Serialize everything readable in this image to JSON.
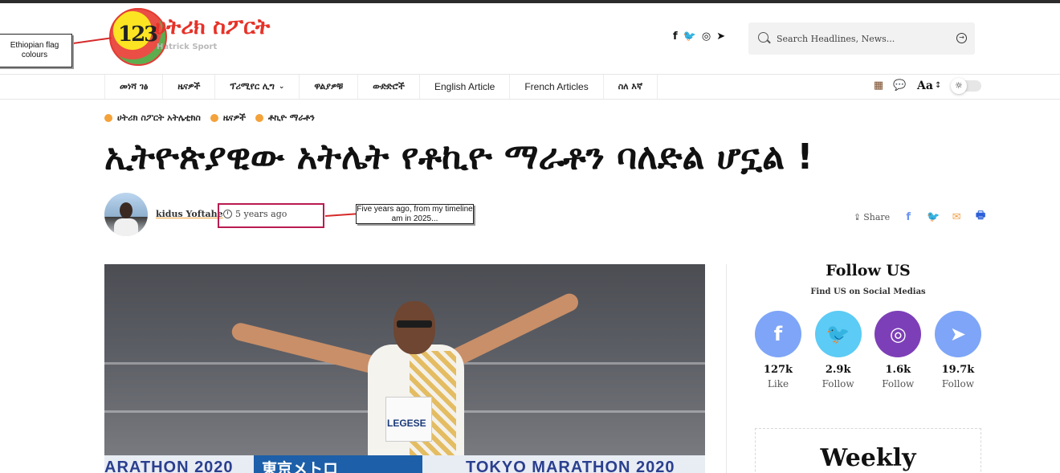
{
  "header": {
    "logo_text": "ሀትሪክ ስፖርት",
    "logo_sub": "Hatrick Sport",
    "logo_numbers": "123",
    "social_icons": [
      "facebook-icon",
      "twitter-icon",
      "instagram-icon",
      "telegram-icon"
    ],
    "search_placeholder": "Search Headlines, News..."
  },
  "annotations": {
    "flag_note": "Ethiopian flag colours",
    "time_note": "Five years ago, from my timeline am  in  2025..."
  },
  "nav": {
    "items": [
      {
        "label": "መነሻ ገፅ"
      },
      {
        "label": "ዜናዎች"
      },
      {
        "label": "ፕሪሚየር ሊግ"
      },
      {
        "label": "ዋልያዎቹ"
      },
      {
        "label": "ውድድሮች"
      },
      {
        "label": "English Article"
      },
      {
        "label": "French Articles"
      },
      {
        "label": "ስለ እኛ"
      }
    ],
    "font_size_label": "Aa"
  },
  "article": {
    "categories": [
      "ሀትሪክ ስፖርት አትሌቲክስ",
      "ዜናዎች",
      "ቶኪዮ ማራቶን"
    ],
    "title": "ኢትዮጵያዊው አትሌት የቶኪዮ ማራቶን ባለድል ሆኗል !",
    "author": "kidus Yoftahe",
    "time": "5 years ago",
    "share_label": "Share",
    "image": {
      "bib_name": "LEGESE",
      "banner_left": "ARATHON 2020",
      "banner_logo": "東京メトロ",
      "banner_right": "TOKYO MARATHON 2020"
    }
  },
  "sidebar": {
    "follow_title": "Follow US",
    "follow_sub": "Find US on Social Medias",
    "networks": [
      {
        "icon": "facebook-icon",
        "glyph": "f",
        "count": "127k",
        "label": "Like",
        "color": "#7ea5f7"
      },
      {
        "icon": "twitter-icon",
        "glyph": "🐦",
        "count": "2.9k",
        "label": "Follow",
        "color": "#5ccbf5"
      },
      {
        "icon": "instagram-icon",
        "glyph": "◎",
        "count": "1.6k",
        "label": "Follow",
        "color": "#7d3fb8"
      },
      {
        "icon": "telegram-icon",
        "glyph": "➤",
        "count": "19.7k",
        "label": "Follow",
        "color": "#7ea5f7"
      }
    ],
    "weekly_title": "Weekly"
  }
}
